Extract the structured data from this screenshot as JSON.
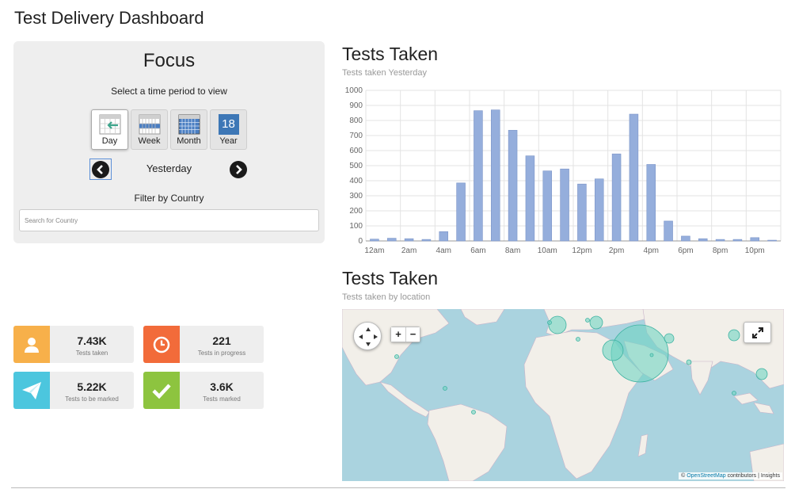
{
  "page": {
    "title": "Test Delivery Dashboard"
  },
  "focus": {
    "title": "Focus",
    "subtitle": "Select a time period to view",
    "periods": [
      {
        "label": "Day",
        "icon": "calendar-day-icon"
      },
      {
        "label": "Week",
        "icon": "calendar-week-icon"
      },
      {
        "label": "Month",
        "icon": "calendar-month-icon"
      },
      {
        "label": "Year",
        "icon": "calendar-year-icon",
        "icon_text": "18"
      }
    ],
    "active_period": "Day",
    "current_period_label": "Yesterday",
    "filter_label": "Filter by Country",
    "country_placeholder": "Search for Country"
  },
  "stats": [
    {
      "value": "7.43K",
      "caption": "Tests taken",
      "color": "#f7b04a",
      "icon": "user-icon"
    },
    {
      "value": "221",
      "caption": "Tests in progress",
      "color": "#f26b3a",
      "icon": "clock-icon"
    },
    {
      "value": "5.22K",
      "caption": "Tests to be marked",
      "color": "#4cc6de",
      "icon": "paper-plane-icon"
    },
    {
      "value": "3.6K",
      "caption": "Tests marked",
      "color": "#8dc43f",
      "icon": "check-icon"
    }
  ],
  "chart_section": {
    "title": "Tests Taken",
    "subtitle": "Tests taken Yesterday"
  },
  "map_section": {
    "title": "Tests Taken",
    "subtitle": "Tests taken by location"
  },
  "map": {
    "zoom_in": "+",
    "zoom_out": "−",
    "attribution_prefix": "©",
    "attribution_link": "OpenStreetMap",
    "attribution_suffix": "contributors | Insights",
    "water_color": "#aad3df",
    "land_color": "#f2efe9",
    "marker_color": "#6fd3c3"
  },
  "chart_data": {
    "type": "bar",
    "x": [
      0,
      1,
      2,
      3,
      4,
      5,
      6,
      7,
      8,
      9,
      10,
      11,
      12,
      13,
      14,
      15,
      16,
      17,
      18,
      19,
      20,
      21,
      22,
      23
    ],
    "tick_labels": [
      "12am",
      "2am",
      "4am",
      "6am",
      "8am",
      "10am",
      "12pm",
      "2pm",
      "4pm",
      "6pm",
      "8pm",
      "10pm"
    ],
    "tick_every": 2,
    "values": [
      12,
      18,
      15,
      10,
      62,
      385,
      865,
      870,
      735,
      565,
      465,
      478,
      378,
      412,
      578,
      842,
      508,
      132,
      32,
      15,
      10,
      10,
      22,
      5
    ],
    "ylim": [
      0,
      1000
    ],
    "yticks": [
      0,
      100,
      200,
      300,
      400,
      500,
      600,
      700,
      800,
      900,
      1000
    ],
    "bar_color": "#95aedc",
    "grid": true
  }
}
